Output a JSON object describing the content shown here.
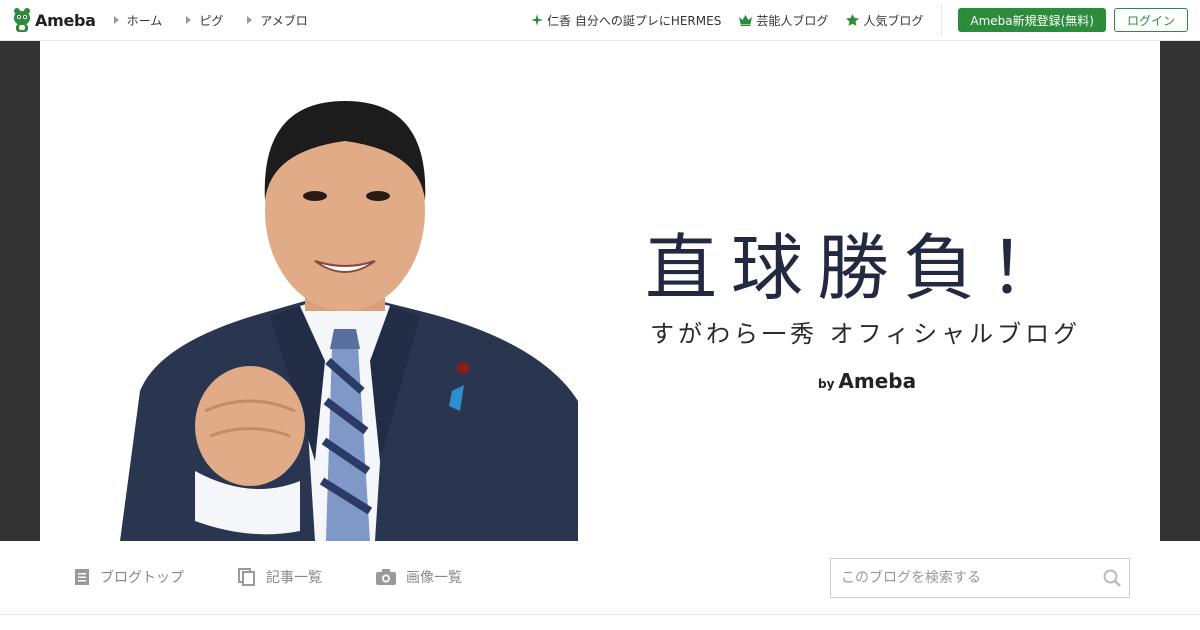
{
  "header": {
    "logo_text": "Ameba",
    "nav": [
      {
        "label": "ホーム"
      },
      {
        "label": "ピグ"
      },
      {
        "label": "アメブロ"
      }
    ],
    "featured_link": "仁香 自分への誕プレにHERMES",
    "geinou_link": "芸能人ブログ",
    "ninki_link": "人気ブログ",
    "register_label": "Ameba新規登録(無料)",
    "login_label": "ログイン"
  },
  "banner": {
    "title": "直球勝負！",
    "subtitle": "すがわら一秀 オフィシャルブログ",
    "by_prefix": "by",
    "by_brand": "Ameba"
  },
  "subnav": {
    "tabs": [
      {
        "label": "ブログトップ",
        "icon": "document-icon"
      },
      {
        "label": "記事一覧",
        "icon": "pages-icon"
      },
      {
        "label": "画像一覧",
        "icon": "camera-icon"
      }
    ],
    "search_placeholder": "このブログを検索する"
  },
  "colors": {
    "brand_green": "#2d8c3c",
    "side_bg": "#333333",
    "title_navy": "#232a40"
  }
}
